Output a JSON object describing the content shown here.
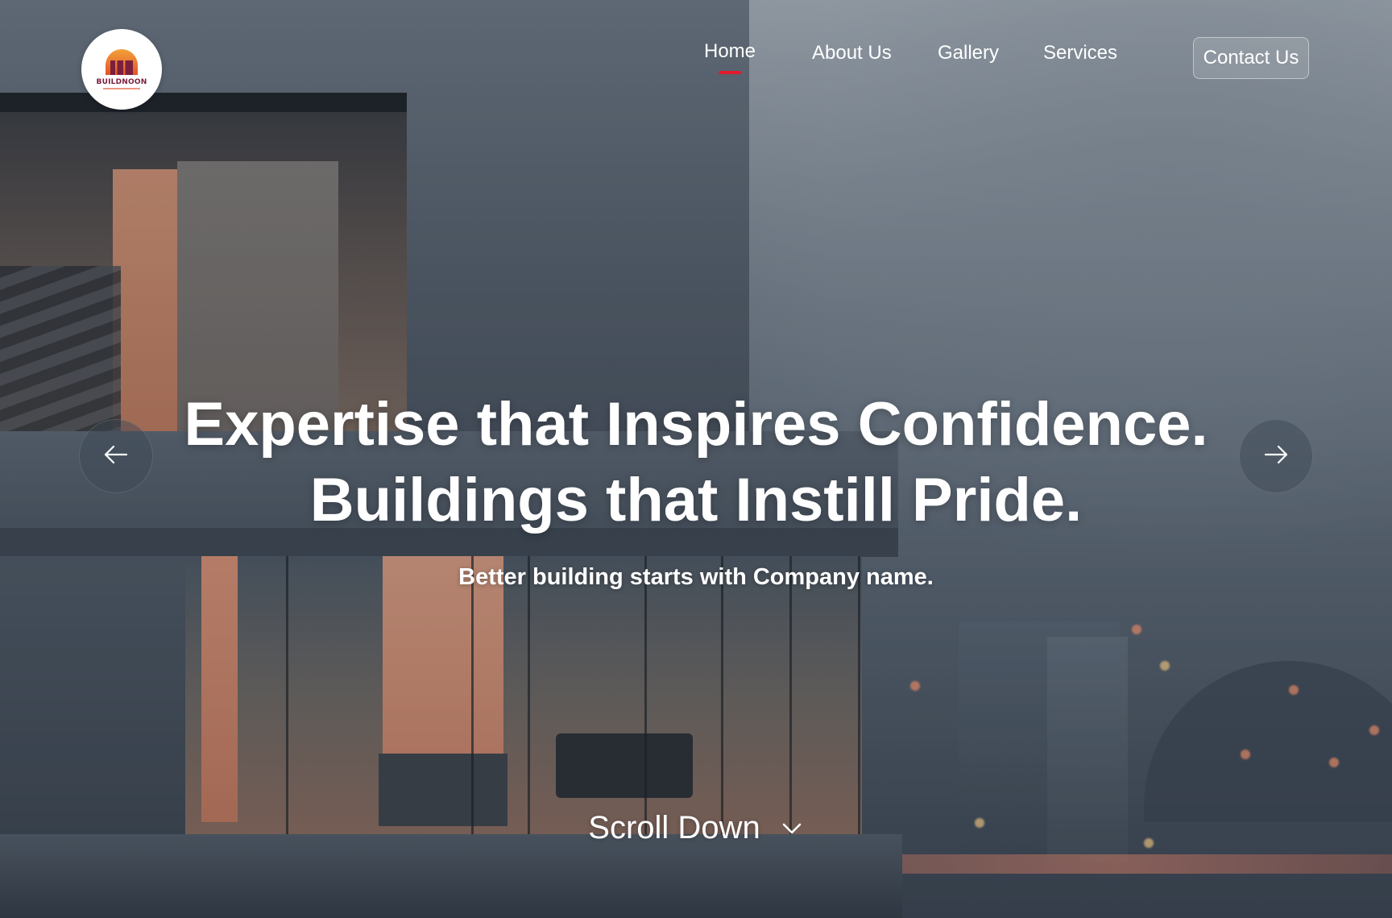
{
  "brand": {
    "logo_text": "BUILDNOON",
    "colors": {
      "primary": "#7a1f3d",
      "accent_orange": "#e0542a",
      "accent_yellow": "#f2a23a"
    }
  },
  "nav": {
    "items": [
      {
        "label": "Home",
        "active": true
      },
      {
        "label": "About Us",
        "active": false
      },
      {
        "label": "Gallery",
        "active": false
      },
      {
        "label": "Services",
        "active": false
      }
    ],
    "active_indicator_color": "#e3192c",
    "contact_label": "Contact Us"
  },
  "hero": {
    "headline_line1": "Expertise that Inspires Confidence.",
    "headline_line2": "Buildings that Instill Pride.",
    "subheadline": "Better building starts with Company name.",
    "prev_icon": "arrow-left-icon",
    "next_icon": "arrow-right-icon",
    "scroll_label": "Scroll Down",
    "scroll_icon": "chevron-down-icon"
  }
}
